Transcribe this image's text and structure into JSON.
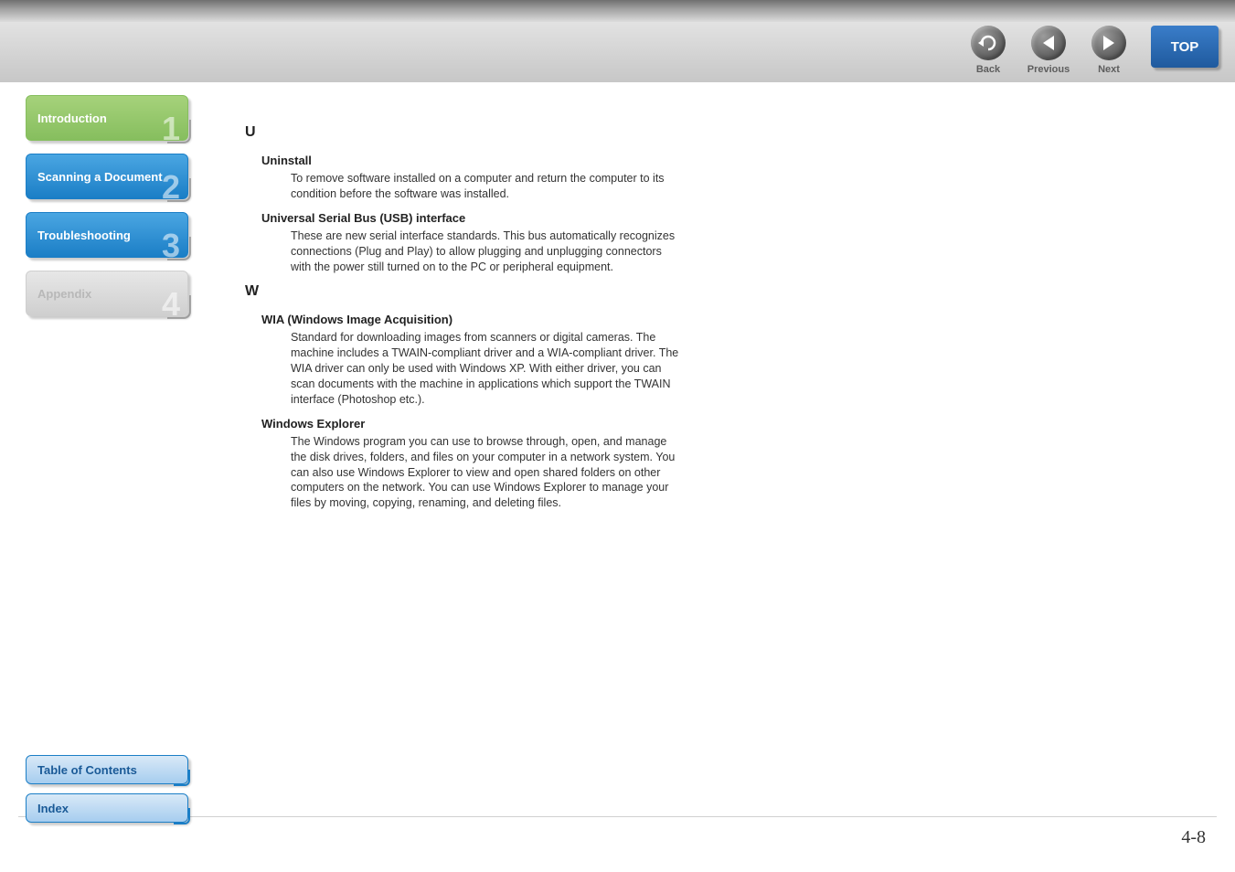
{
  "header": {
    "back": "Back",
    "previous": "Previous",
    "next": "Next",
    "top": "TOP"
  },
  "sidebar": {
    "items": [
      {
        "label": "Introduction",
        "num": "1"
      },
      {
        "label": "Scanning a Document",
        "num": "2"
      },
      {
        "label": "Troubleshooting",
        "num": "3"
      },
      {
        "label": "Appendix",
        "num": "4"
      }
    ]
  },
  "bottomNav": {
    "toc": "Table of Contents",
    "index": "Index"
  },
  "glossary": {
    "u": {
      "letter": "U",
      "entries": [
        {
          "term": "Uninstall",
          "def": "To remove software installed on a computer and return the computer to its condition before the software was installed."
        },
        {
          "term": "Universal Serial Bus (USB) interface",
          "def": "These are new serial interface standards. This bus automatically recognizes connections (Plug and Play) to allow plugging and unplugging connectors with the power still turned on to the PC or peripheral equipment."
        }
      ]
    },
    "w": {
      "letter": "W",
      "entries": [
        {
          "term": "WIA (Windows Image Acquisition)",
          "def": "Standard for downloading images from scanners or digital cameras. The machine includes a TWAIN-compliant driver and a WIA-compliant driver. The WIA driver can only be used with Windows XP. With either driver, you can scan documents with the machine in applications which support the TWAIN interface (Photoshop etc.)."
        },
        {
          "term": "Windows Explorer",
          "def": "The Windows program you can use to browse through, open, and manage the disk drives, folders, and files on your computer in a network system. You can also use Windows Explorer to view and open shared folders on other computers on the network. You can use Windows Explorer to manage your files by moving, copying, renaming, and deleting files."
        }
      ]
    }
  },
  "pageNumber": "4-8"
}
